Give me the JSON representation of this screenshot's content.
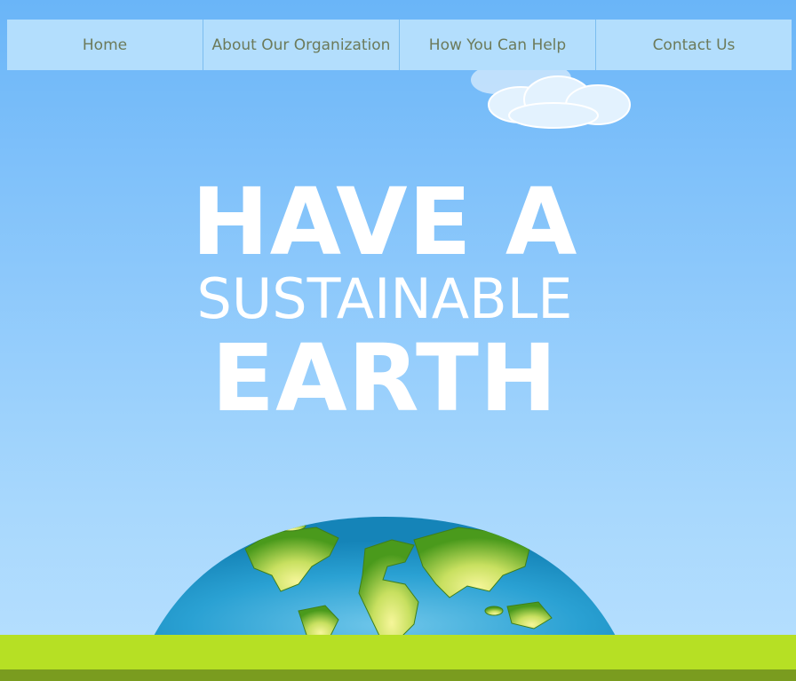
{
  "nav": {
    "items": [
      {
        "label": "Home"
      },
      {
        "label": "About Our Organization"
      },
      {
        "label": "How You Can Help"
      },
      {
        "label": "Contact Us"
      }
    ]
  },
  "hero": {
    "line1": "HAVE A",
    "line2": "SUSTAINABLE",
    "line3": "EARTH"
  },
  "colors": {
    "sky_top": "#6ab5f8",
    "sky_bottom": "#b8e0fe",
    "nav_background": "#b3defd",
    "nav_text": "#6c7a5a",
    "grass": "#b6e024",
    "soil": "#7a9c1f",
    "ocean": "#1a8fc4",
    "land": "#9acd32"
  },
  "decorations": {
    "cloud": "cloud-icon",
    "globe": "earth-globe-icon"
  }
}
